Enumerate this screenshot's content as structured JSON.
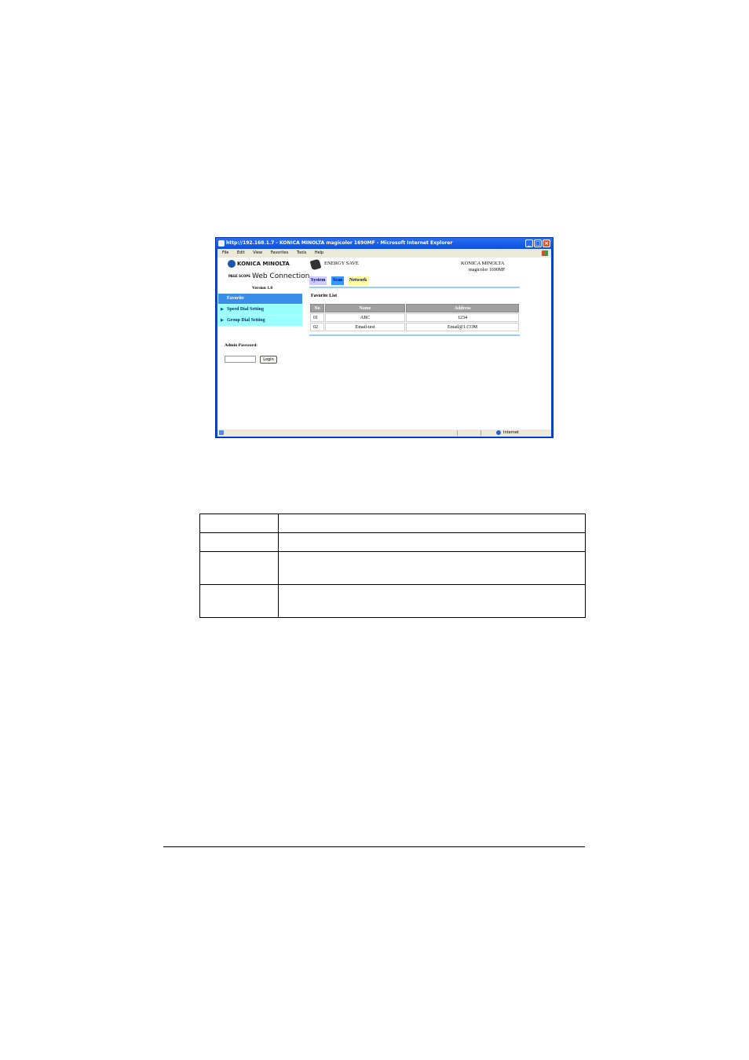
{
  "window": {
    "title": "http://192.168.1.7 - KONICA MINOLTA magicolor 1690MF - Microsoft Internet Explorer",
    "menu": [
      "File",
      "Edit",
      "View",
      "Favorites",
      "Tools",
      "Help"
    ],
    "status_zone": "Internet"
  },
  "page": {
    "brand_logo": "KONICA MINOLTA",
    "pagescope_mark": "PAGE SCOPE",
    "pagescope_title": "Web Connection",
    "version": "Version 1.0",
    "energy_save": "ENERGY SAVE",
    "brand": "KONICA MINOLTA",
    "model": "magicolor 1690MF",
    "tabs": [
      {
        "label": "System"
      },
      {
        "label": "Scan"
      },
      {
        "label": "Network"
      }
    ],
    "sidebar": [
      {
        "label": "Favorite"
      },
      {
        "label": "Speed Dial Setting"
      },
      {
        "label": "Group Dial Setting"
      }
    ],
    "admin_password_label": "Admin Password:",
    "login_label": "Login",
    "favorite_list": {
      "title": "Favorite List",
      "columns": [
        "No",
        "Name",
        "Address"
      ],
      "rows": [
        [
          "01",
          "ABC",
          "1234"
        ],
        [
          "02",
          "Email-test",
          "Email@1.COM"
        ]
      ]
    }
  },
  "colors": {
    "tab_system": "#ccccff",
    "tab_scan": "#3399ff",
    "tab_network": "#ffff99",
    "sidebar_active": "#3a8ee8",
    "sidebar_item": "#99ffff"
  }
}
